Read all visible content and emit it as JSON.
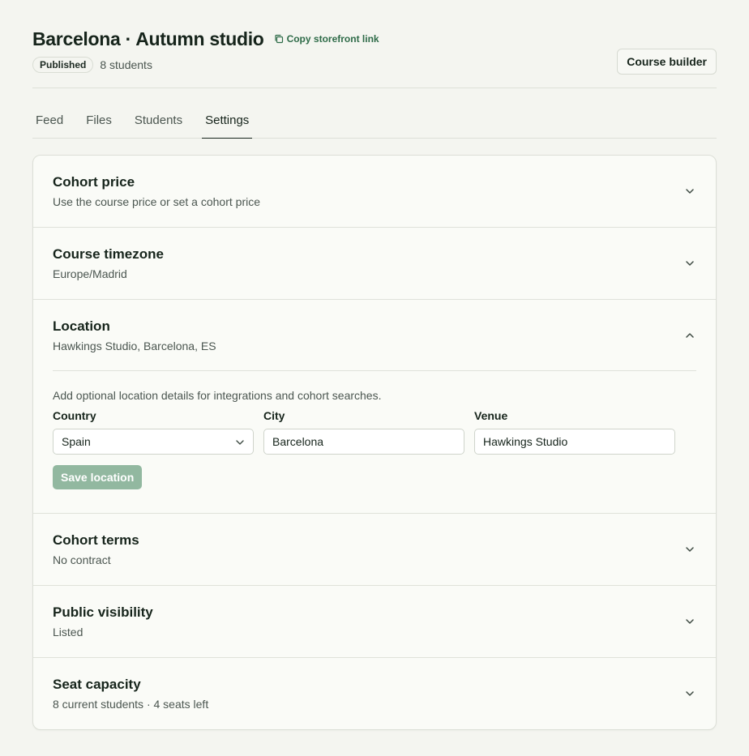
{
  "header": {
    "title": "Barcelona · Autumn studio",
    "copy_link": "Copy storefront link",
    "status_badge": "Published",
    "students": "8 students",
    "builder_button": "Course builder"
  },
  "tabs": [
    {
      "label": "Feed"
    },
    {
      "label": "Files"
    },
    {
      "label": "Students"
    },
    {
      "label": "Settings",
      "active": true
    }
  ],
  "sections": {
    "price": {
      "title": "Cohort price",
      "subtitle": "Use the course price or set a cohort price"
    },
    "timezone": {
      "title": "Course timezone",
      "subtitle": "Europe/Madrid"
    },
    "location": {
      "title": "Location",
      "subtitle": "Hawkings Studio, Barcelona, ES",
      "description": "Add optional location details for integrations and cohort searches.",
      "country_label": "Country",
      "country_value": "Spain",
      "city_label": "City",
      "city_value": "Barcelona",
      "venue_label": "Venue",
      "venue_value": "Hawkings Studio",
      "save_button": "Save location"
    },
    "terms": {
      "title": "Cohort terms",
      "subtitle": "No contract"
    },
    "visibility": {
      "title": "Public visibility",
      "subtitle": "Listed"
    },
    "capacity": {
      "title": "Seat capacity",
      "subtitle": "8 current students · 4 seats left"
    }
  },
  "colors": {
    "accent": "#2e6b48",
    "save_button_disabled": "#92b8a0",
    "background": "#f4f5f0"
  },
  "icons": [
    "copy-icon",
    "chevron-down-icon",
    "chevron-up-icon"
  ]
}
